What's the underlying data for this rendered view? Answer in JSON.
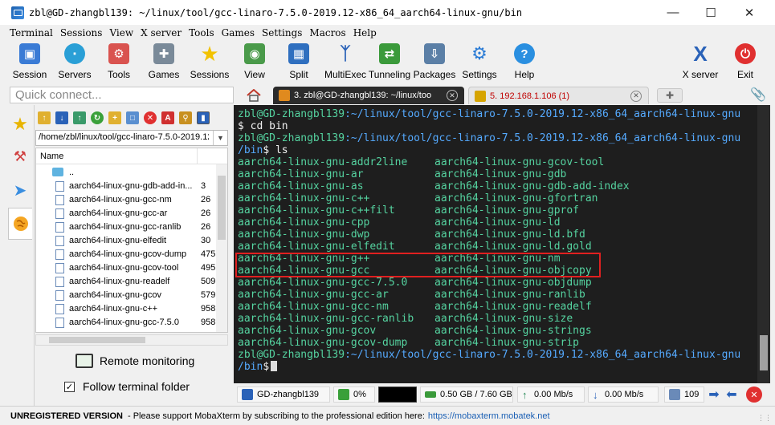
{
  "window": {
    "title": "zbl@GD-zhangbl139: ~/linux/tool/gcc-linaro-7.5.0-2019.12-x86_64_aarch64-linux-gnu/bin"
  },
  "menu": [
    "Terminal",
    "Sessions",
    "View",
    "X server",
    "Tools",
    "Games",
    "Settings",
    "Macros",
    "Help"
  ],
  "toolbar": {
    "session": "Session",
    "servers": "Servers",
    "tools": "Tools",
    "games": "Games",
    "sessions": "Sessions",
    "view": "View",
    "split": "Split",
    "multiexec": "MultiExec",
    "tunneling": "Tunneling",
    "packages": "Packages",
    "settings": "Settings",
    "help": "Help",
    "xserver": "X server",
    "exit": "Exit"
  },
  "quick_connect_placeholder": "Quick connect...",
  "tabs": {
    "active": "3. zbl@GD-zhangbl139: ~/linux/too",
    "inactive": "5. 192.168.1.106 (1)"
  },
  "sftp": {
    "path": "/home/zbl/linux/tool/gcc-linaro-7.5.0-2019.12-",
    "column_name": "Name",
    "parent": "..",
    "files": [
      {
        "name": "aarch64-linux-gnu-gdb-add-in...",
        "size": "3"
      },
      {
        "name": "aarch64-linux-gnu-gcc-nm",
        "size": "26"
      },
      {
        "name": "aarch64-linux-gnu-gcc-ar",
        "size": "26"
      },
      {
        "name": "aarch64-linux-gnu-gcc-ranlib",
        "size": "26"
      },
      {
        "name": "aarch64-linux-gnu-elfedit",
        "size": "30"
      },
      {
        "name": "aarch64-linux-gnu-gcov-dump",
        "size": "475"
      },
      {
        "name": "aarch64-linux-gnu-gcov-tool",
        "size": "495"
      },
      {
        "name": "aarch64-linux-gnu-readelf",
        "size": "509"
      },
      {
        "name": "aarch64-linux-gnu-gcov",
        "size": "579"
      },
      {
        "name": "aarch64-linux-gnu-c++",
        "size": "958"
      },
      {
        "name": "aarch64-linux-gnu-gcc-7.5.0",
        "size": "958"
      }
    ],
    "remote_monitoring": "Remote monitoring",
    "follow_terminal_folder": "Follow terminal folder",
    "follow_checked": "✓"
  },
  "terminal": {
    "prompt_user": "zbl@GD-zhangbl139",
    "prompt_path_1": ":~/linux/tool/gcc-linaro-7.5.0-2019.12-x86_64_aarch64-linux-gnu",
    "prompt_end_1": "$ cd bin",
    "prompt_path_2": ":~/linux/tool/gcc-linaro-7.5.0-2019.12-x86_64_aarch64-linux-gnu",
    "prompt_path_2b": "/bin",
    "cmd_ls": "$ ls",
    "prompt_path_3": ":~/linux/tool/gcc-linaro-7.5.0-2019.12-x86_64_aarch64-linux-gnu",
    "prompt_path_3b": "/bin",
    "prompt_end_3": "$",
    "ls_col1": [
      "aarch64-linux-gnu-addr2line",
      "aarch64-linux-gnu-ar",
      "aarch64-linux-gnu-as",
      "aarch64-linux-gnu-c++",
      "aarch64-linux-gnu-c++filt",
      "aarch64-linux-gnu-cpp",
      "aarch64-linux-gnu-dwp",
      "aarch64-linux-gnu-elfedit",
      "aarch64-linux-gnu-g++",
      "aarch64-linux-gnu-gcc",
      "aarch64-linux-gnu-gcc-7.5.0",
      "aarch64-linux-gnu-gcc-ar",
      "aarch64-linux-gnu-gcc-nm",
      "aarch64-linux-gnu-gcc-ranlib",
      "aarch64-linux-gnu-gcov",
      "aarch64-linux-gnu-gcov-dump"
    ],
    "ls_col2": [
      "aarch64-linux-gnu-gcov-tool",
      "aarch64-linux-gnu-gdb",
      "aarch64-linux-gnu-gdb-add-index",
      "aarch64-linux-gnu-gfortran",
      "aarch64-linux-gnu-gprof",
      "aarch64-linux-gnu-ld",
      "aarch64-linux-gnu-ld.bfd",
      "aarch64-linux-gnu-ld.gold",
      "aarch64-linux-gnu-nm",
      "aarch64-linux-gnu-objcopy",
      "aarch64-linux-gnu-objdump",
      "aarch64-linux-gnu-ranlib",
      "aarch64-linux-gnu-readelf",
      "aarch64-linux-gnu-size",
      "aarch64-linux-gnu-strings",
      "aarch64-linux-gnu-strip"
    ]
  },
  "status": {
    "host": "GD-zhangbl139",
    "cpu": "0%",
    "memory": "0.50 GB / 7.60 GB",
    "upload": "0.00 Mb/s",
    "download": "0.00 Mb/s",
    "users": "109"
  },
  "notice": {
    "label": "UNREGISTERED VERSION",
    "text": "-  Please support MobaXterm by subscribing to the professional edition here:",
    "link": "https://mobaxterm.mobatek.net"
  },
  "colors": {
    "terminal_bg": "#1e1e1e",
    "terminal_green": "#55d3a0",
    "terminal_blue": "#55aaff",
    "highlight_red": "#e02020"
  }
}
